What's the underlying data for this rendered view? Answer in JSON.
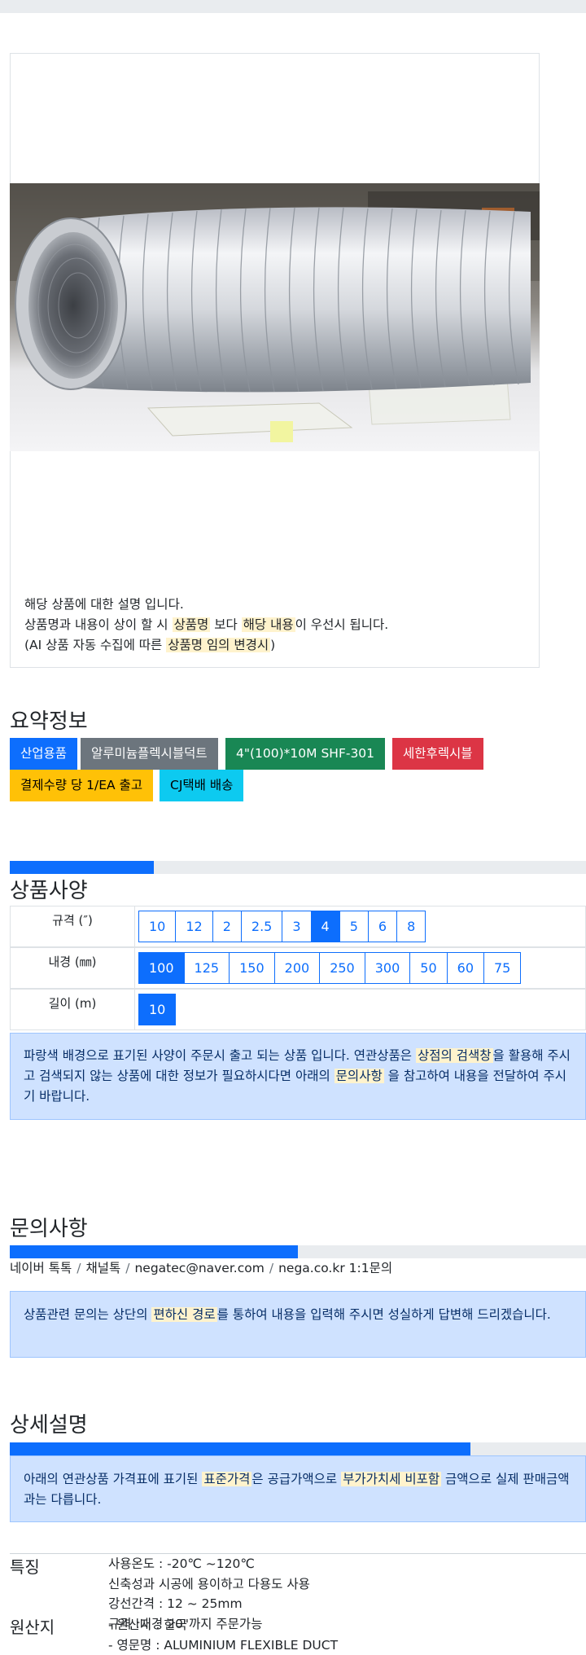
{
  "product": {
    "image_alt": "알루미늄 플렉시블 덕트",
    "description_lines": {
      "l1": "해당 상품에 대한 설명 입니다.",
      "l2_a": "상품명과 내용이 상이 할 시 ",
      "l2_m1": "상품명",
      "l2_b": " 보다 ",
      "l2_m2": "해당 내용",
      "l2_c": "이 우선시 됩니다.",
      "l3_a": "(AI 상품 자동 수집에 따른 ",
      "l3_m": "상품명 임의 변경시",
      "l3_b": ")"
    }
  },
  "summary": {
    "title": "요약정보",
    "badges": [
      {
        "label": "산업용품",
        "color": "#0d6efd"
      },
      {
        "label": "알루미늄플렉시블덕트",
        "color": "#6c757d"
      },
      {
        "label": "4\"(100)*10M SHF-301",
        "color": "#198754"
      },
      {
        "label": "세한후렉시블",
        "color": "#dc3545"
      },
      {
        "label": "결제수량 당 1/EA 출고",
        "color": "#ffc107"
      },
      {
        "label": "CJ택배 배송",
        "color": "#0dcaf0"
      }
    ]
  },
  "specs": {
    "title": "상품사양",
    "progress": 0.25,
    "rows": [
      {
        "label": "규격 (″)",
        "options": [
          "10",
          "12",
          "2",
          "2.5",
          "3",
          "4",
          "5",
          "6",
          "8"
        ],
        "selected": "4"
      },
      {
        "label": "내경 (㎜)",
        "options": [
          "100",
          "125",
          "150",
          "200",
          "250",
          "300",
          "50",
          "60",
          "75"
        ],
        "selected": "100"
      },
      {
        "label": "길이 (m)",
        "options": [
          "10"
        ],
        "selected": "10"
      }
    ],
    "notice": {
      "a": "파랑색 배경으로 표기된 사양이 주문시 출고 되는 상품 입니다. 연관상품은 ",
      "m1": "상점의 검색창",
      "b": "을 활용해 주시고 검색되지 않는 상품에 대한 정보가 필요하시다면 아래의 ",
      "m2": "문의사항",
      "c": " 을 참고하여 내용을 전달하여 주시기 바랍니다."
    }
  },
  "inquiry": {
    "title": "문의사항",
    "progress": 0.5,
    "contacts": [
      "네이버 톡톡",
      "채널톡",
      "negatec@naver.com",
      "nega.co.kr 1:1문의"
    ],
    "notice": {
      "a": "상품관련 문의는 상단의 ",
      "m": "편하신 경로",
      "b": "를 통하여 내용을 입력해 주시면 성실하게 답변해 드리겠습니다."
    }
  },
  "detail": {
    "title": "상세설명",
    "progress": 0.8,
    "notice": {
      "a": "아래의 연관상품 가격표에 표기된 ",
      "m1": "표준가격",
      "b": "은 공급가액으로 ",
      "m2": "부가가치세 비포함",
      "c": " 금액으로 실제 판매금액과는 다릅니다."
    },
    "features": {
      "key": "특징",
      "lines": [
        "사용온도 : -20℃ ~120℃",
        "신축성과 시공에 용이하고 다용도 사용",
        "강선간격 : 12 ~ 25mm",
        "규격 :내경 20\"까지 주문가능"
      ]
    },
    "origin": {
      "key": "원산지",
      "lines": [
        "- 원산지 : 한국",
        "- 영문명 : ALUMINIUM FLEXIBLE DUCT"
      ]
    }
  }
}
